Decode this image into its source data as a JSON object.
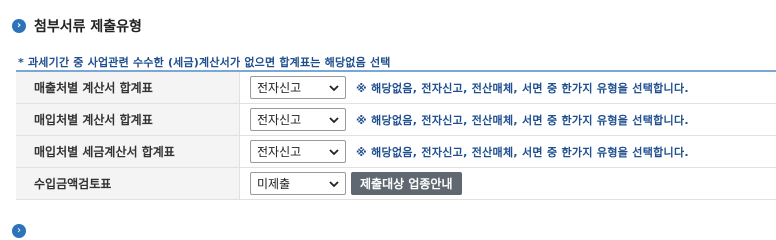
{
  "section": {
    "title": "첨부서류 제출유형",
    "bullet_icon": "arrow-right-circle-icon"
  },
  "note": "* 과세기간 중 사업관련 수수한 (세금)계산서가 없으면 합계표는 해당없음 선택",
  "rows": [
    {
      "label": "매출처별 계산서 합계표",
      "value": "전자신고",
      "hint": "※ 해당없음, 전자신고, 전산매체, 서면 중 한가지 유형을 선택합니다."
    },
    {
      "label": "매입처별 계산서 합계표",
      "value": "전자신고",
      "hint": "※ 해당없음, 전자신고, 전산매체, 서면 중 한가지 유형을 선택합니다."
    },
    {
      "label": "매입처별 세금계산서 합계표",
      "value": "전자신고",
      "hint": "※ 해당없음, 전자신고, 전산매체, 서면 중 한가지 유형을 선택합니다."
    },
    {
      "label": "수입금액검토표",
      "value": "미제출",
      "button": "제출대상 업종안내"
    }
  ],
  "next_section": {
    "title": ""
  },
  "colors": {
    "accent": "#2d73b9",
    "note_text": "#1f4f8f",
    "button_bg": "#5f6870"
  }
}
